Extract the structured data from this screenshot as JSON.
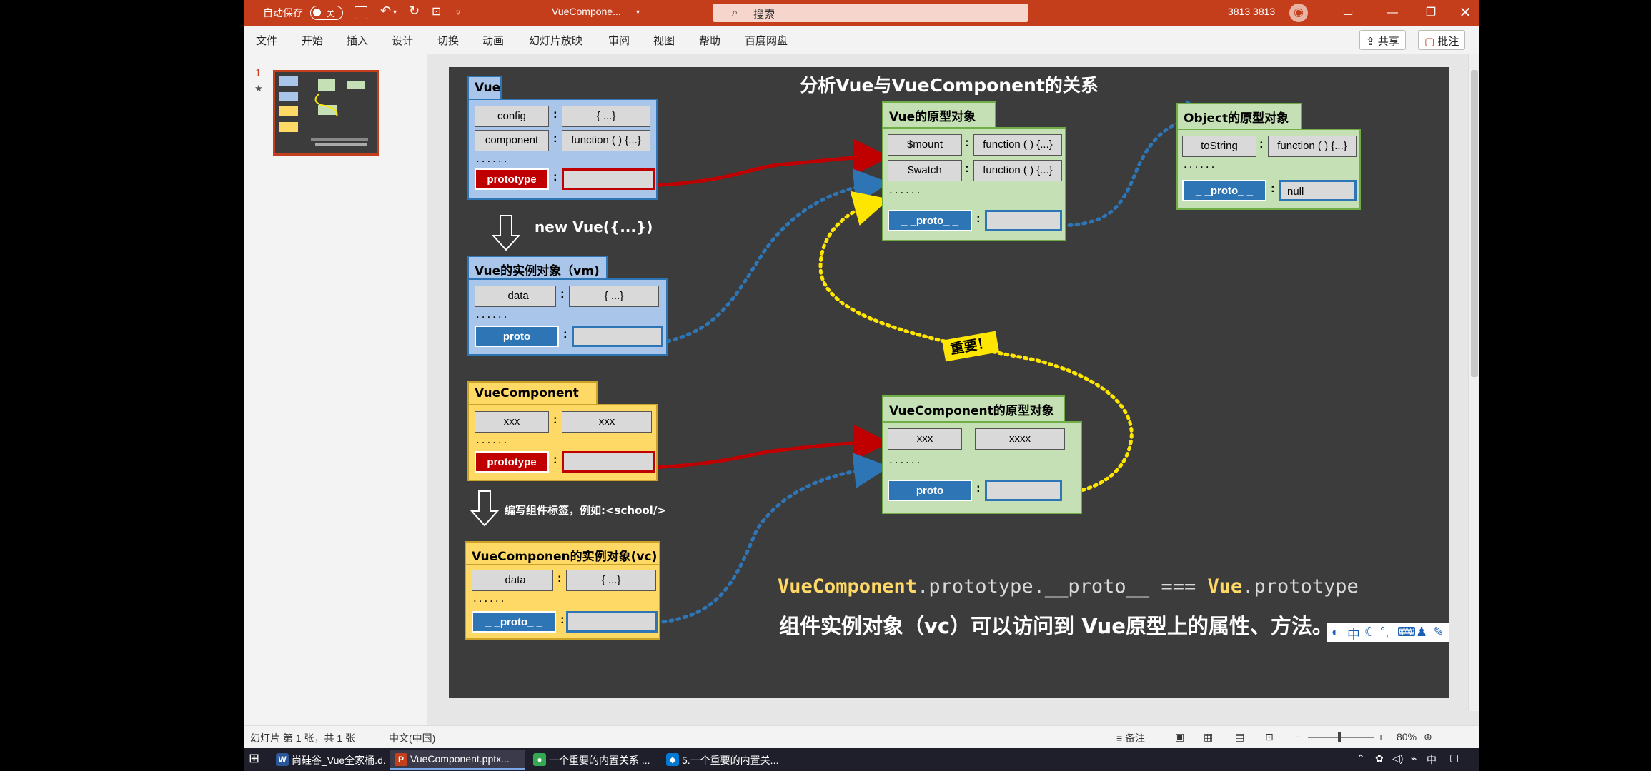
{
  "titlebar": {
    "autosave_label": "自动保存",
    "autosave_state": "关",
    "doc_title": "VueCompone...",
    "search_placeholder": "搜索",
    "user_name": "3813 3813"
  },
  "menu": {
    "items": [
      "文件",
      "开始",
      "插入",
      "设计",
      "切换",
      "动画",
      "幻灯片放映",
      "审阅",
      "视图",
      "帮助",
      "百度网盘"
    ],
    "share_label": "共享",
    "comment_label": "批注"
  },
  "thumbnails": {
    "number": "1",
    "star": "★"
  },
  "slide": {
    "title": "分析Vue与VueComponent的关系",
    "vue": {
      "header": "Vue",
      "rows": [
        {
          "key": "config",
          "value": "{ ...}"
        },
        {
          "key": "component",
          "value": "function ( ) {...}"
        }
      ],
      "dots": "......",
      "prototype": "prototype"
    },
    "new_vue": "new Vue({...})",
    "vm": {
      "header": "Vue的实例对象（vm)",
      "rows": [
        {
          "key": "_data",
          "value": "{ ...}"
        }
      ],
      "dots": "......",
      "proto": "_ _proto_ _"
    },
    "vuecomponent": {
      "header": "VueComponent",
      "rows": [
        {
          "key": "xxx",
          "value": "xxx"
        }
      ],
      "dots": "......",
      "prototype": "prototype"
    },
    "write_tag": "编写组件标签，例如:<school/>",
    "vc": {
      "header": "VueComponen的实例对象(vc)",
      "rows": [
        {
          "key": "_data",
          "value": "{ ...}"
        }
      ],
      "dots": "......",
      "proto": "_ _proto_ _"
    },
    "vue_proto": {
      "header": "Vue的原型对象",
      "rows": [
        {
          "key": "$mount",
          "value": "function ( ) {...}"
        },
        {
          "key": "$watch",
          "value": "function ( ) {...}"
        }
      ],
      "dots": "......",
      "proto": "_ _proto_ _"
    },
    "object_proto": {
      "header": "Object的原型对象",
      "rows": [
        {
          "key": "toString",
          "value": "function ( ) {...}"
        }
      ],
      "dots": "......",
      "proto": "_ _proto_ _",
      "proto_value": "null"
    },
    "vc_proto": {
      "header": "VueComponent的原型对象",
      "rows": [
        {
          "key": "xxx",
          "value": "xxxx"
        }
      ],
      "dots": "......",
      "proto": "_ _proto_ _"
    },
    "important": "重要！",
    "code_a": "VueComponent",
    "code_b": ".prototype.__proto__ === ",
    "code_c": "Vue",
    "code_d": ".prototype",
    "summary": "组件实例对象（vc）可以访问到 Vue原型上的属性、方法。",
    "ime": "中"
  },
  "status": {
    "slide_info": "幻灯片 第 1 张，共 1 张",
    "language": "中文(中国)",
    "notes": "备注",
    "zoom": "80%"
  },
  "taskbar": {
    "tasks": [
      {
        "label": "尚硅谷_Vue全家桶.d...",
        "icon": "W",
        "color": "#2b579a"
      },
      {
        "label": "VueComponent.pptx...",
        "icon": "P",
        "color": "#c43e1c"
      },
      {
        "label": "一个重要的内置关系 ...",
        "icon": "●",
        "color": "#34a853"
      },
      {
        "label": "5.一个重要的内置关...",
        "icon": "◆",
        "color": "#0078d4"
      }
    ],
    "ime": "中"
  },
  "colors": {
    "accent": "#c43e1c",
    "slide_bg": "#3c3c3c",
    "red_arrow": "#c00000",
    "blue_arrow": "#2e75b6",
    "yellow_arrow": "#ffe600"
  }
}
